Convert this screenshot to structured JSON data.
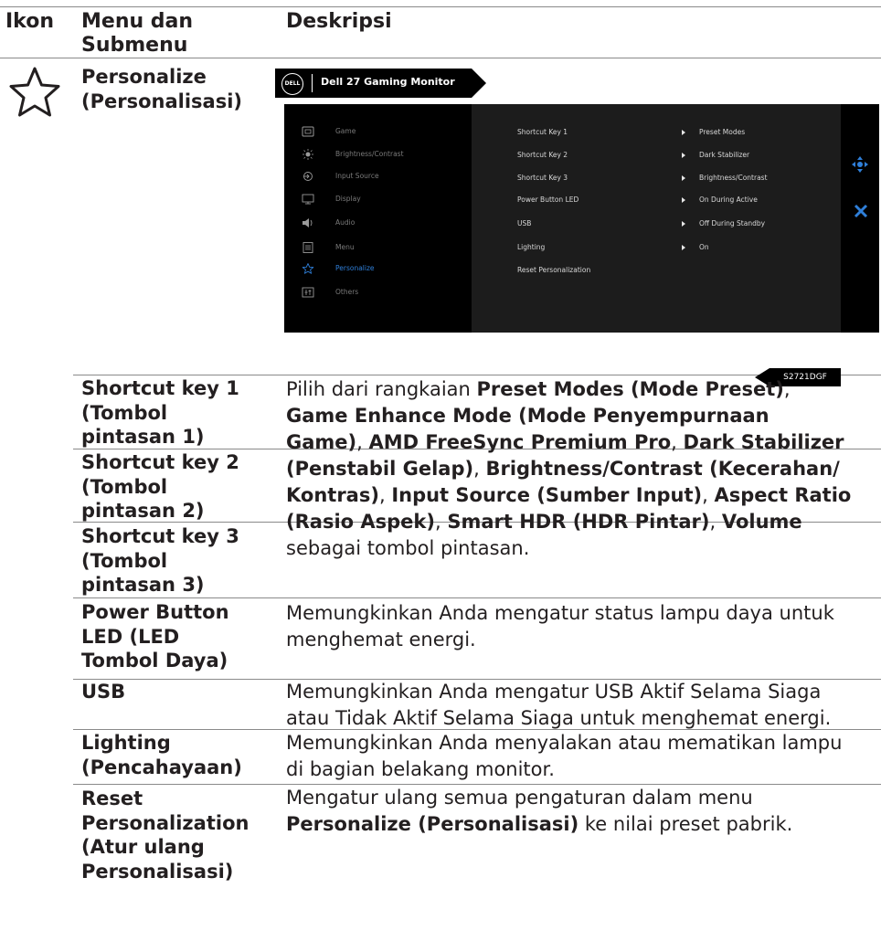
{
  "header": {
    "col_icon": "Ikon",
    "col_menu_line1": "Menu dan",
    "col_menu_line2": "Submenu",
    "col_desc": "Deskripsi"
  },
  "main_row": {
    "icon": "star-icon",
    "title_line1": "Personalize",
    "title_line2": "(Personalisasi)"
  },
  "osd": {
    "brand": "Dell 27 Gaming Monitor",
    "logo_text": "DELL",
    "menu_items": [
      {
        "label": "Game",
        "icon": "game-icon"
      },
      {
        "label": "Brightness/Contrast",
        "icon": "brightness-icon"
      },
      {
        "label": "Input Source",
        "icon": "input-source-icon"
      },
      {
        "label": "Display",
        "icon": "display-icon"
      },
      {
        "label": "Audio",
        "icon": "audio-icon"
      },
      {
        "label": "Menu",
        "icon": "menu-icon"
      },
      {
        "label": "Personalize",
        "icon": "star-icon",
        "active": true
      },
      {
        "label": "Others",
        "icon": "others-icon"
      }
    ],
    "sub_items": [
      {
        "label": "Shortcut Key 1",
        "value": "Preset Modes"
      },
      {
        "label": "Shortcut Key 2",
        "value": "Dark Stabilizer"
      },
      {
        "label": "Shortcut Key 3",
        "value": "Brightness/Contrast"
      },
      {
        "label": "Power Button LED",
        "value": "On During Active"
      },
      {
        "label": "USB",
        "value": "Off During Standby"
      },
      {
        "label": "Lighting",
        "value": "On"
      },
      {
        "label": "Reset Personalization",
        "value": ""
      }
    ],
    "model": "S2721DGF",
    "accent_color": "#2f7fd9",
    "nav_icons": [
      "joystick-icon",
      "close-icon"
    ]
  },
  "rows": {
    "sk1": [
      "Shortcut key 1",
      "(Tombol",
      "pintasan 1)"
    ],
    "sk2": [
      "Shortcut key 2",
      "(Tombol",
      "pintasan 2)"
    ],
    "sk3": [
      "Shortcut key 3",
      "(Tombol",
      "pintasan 3)"
    ],
    "shortcut_desc": {
      "l1_a": "Pilih dari rangkaian ",
      "l1_b": "Preset Modes (Mode Preset)",
      "l1_c": ",",
      "l2": "Game Enhance Mode (Mode Penyempurnaan",
      "l3_a": "Game)",
      "l3_b": ", ",
      "l3_c": "AMD FreeSync Premium Pro",
      "l3_d": ", ",
      "l3_e": "Dark Stabilizer",
      "l4_a": "(Penstabil Gelap)",
      "l4_b": ", ",
      "l4_c": "Brightness/Contrast (Kecerahan/",
      "l5_a": "Kontras)",
      "l5_b": ", ",
      "l5_c": "Input Source (Sumber Input)",
      "l5_d": ", ",
      "l5_e": "Aspect Ratio",
      "l6_a": "(Rasio Aspek)",
      "l6_b": ", ",
      "l6_c": "Smart HDR (HDR Pintar)",
      "l6_d": ", ",
      "l6_e": "Volume",
      "l7": "sebagai tombol pintasan."
    },
    "power": {
      "name": [
        "Power Button",
        "LED (LED",
        "Tombol Daya)"
      ],
      "desc": [
        "Memungkinkan Anda mengatur status lampu daya untuk",
        "menghemat energi."
      ]
    },
    "usb": {
      "name": [
        "USB"
      ],
      "desc": [
        "Memungkinkan Anda mengatur USB Aktif Selama Siaga",
        "atau Tidak Aktif Selama Siaga untuk menghemat energi."
      ]
    },
    "lighting": {
      "name": [
        "Lighting",
        "(Pencahayaan)"
      ],
      "desc": [
        "Memungkinkan Anda menyalakan atau mematikan lampu",
        "di bagian belakang monitor."
      ]
    },
    "reset": {
      "name": [
        "Reset",
        "Personalization",
        "(Atur ulang",
        "Personalisasi)"
      ],
      "desc_l1": "Mengatur ulang semua pengaturan dalam menu",
      "desc_l2_a": "Personalize (Personalisasi)",
      "desc_l2_b": " ke nilai preset pabrik."
    }
  }
}
